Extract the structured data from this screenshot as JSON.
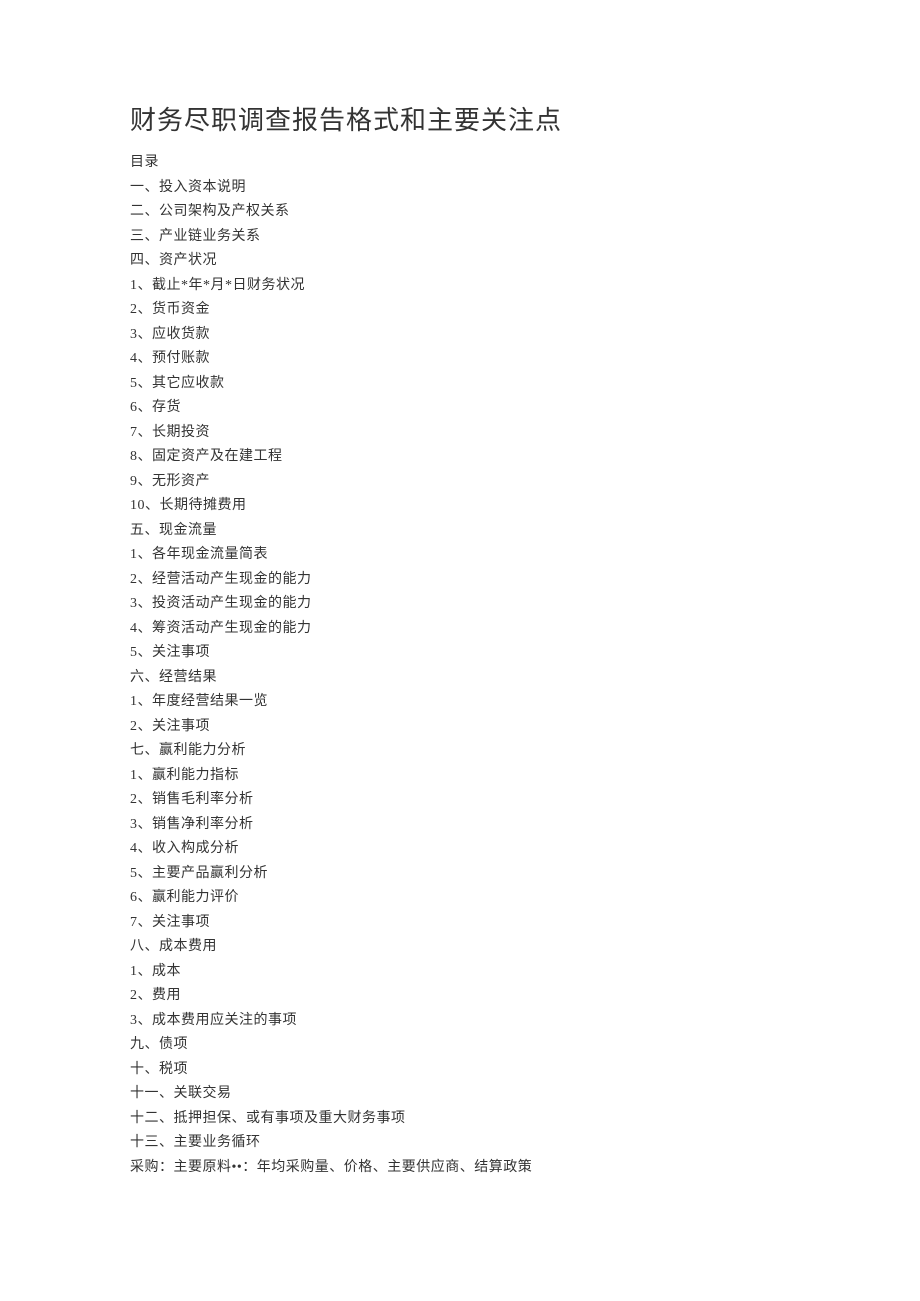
{
  "title": "财务尽职调查报告格式和主要关注点",
  "toc": [
    "目录",
    "一、投入资本说明",
    "二、公司架构及产权关系",
    "三、产业链业务关系",
    "四、资产状况",
    "1、截止*年*月*日财务状况",
    "2、货币资金",
    "3、应收货款",
    "4、预付账款",
    "5、其它应收款",
    "6、存货",
    "7、长期投资",
    "8、固定资产及在建工程",
    "9、无形资产",
    "10、长期待摊费用",
    "五、现金流量",
    "1、各年现金流量简表",
    "2、经营活动产生现金的能力",
    "3、投资活动产生现金的能力",
    "4、筹资活动产生现金的能力",
    "5、关注事项",
    "六、经营结果",
    "1、年度经营结果一览",
    "2、关注事项",
    "七、赢利能力分析",
    "1、赢利能力指标",
    "2、销售毛利率分析",
    "3、销售净利率分析",
    "4、收入构成分析",
    "5、主要产品赢利分析",
    "6、赢利能力评价",
    "7、关注事项",
    "八、成本费用",
    "1、成本",
    "2、费用",
    "3、成本费用应关注的事项",
    "九、债项",
    "十、税项",
    "十一、关联交易",
    "十二、抵押担保、或有事项及重大财务事项",
    "十三、主要业务循环",
    "采购：主要原料••：年均采购量、价格、主要供应商、结算政策"
  ]
}
